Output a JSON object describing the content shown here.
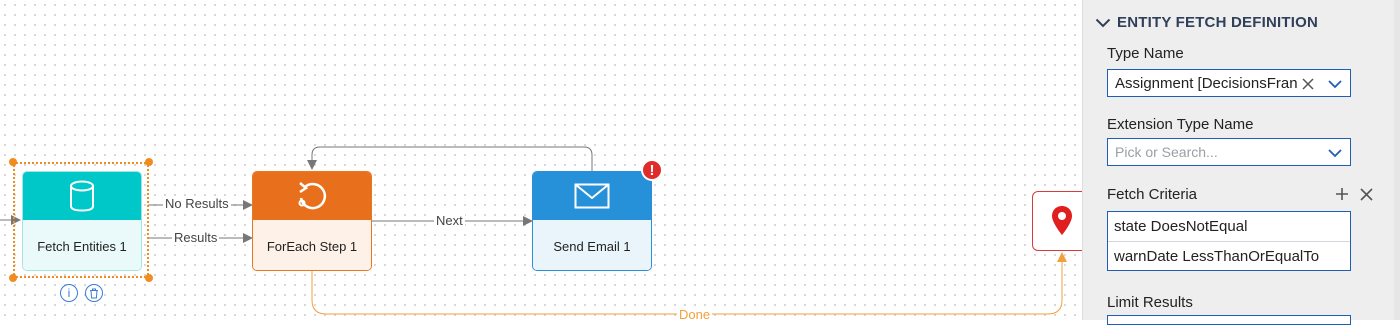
{
  "flow": {
    "nodes": {
      "fetch": {
        "label": "Fetch Entities 1"
      },
      "foreach": {
        "label": "ForEach Step 1"
      },
      "email": {
        "label": "Send Email 1",
        "badge": "!"
      }
    },
    "connections": {
      "no_results": "No Results",
      "results": "Results",
      "next": "Next",
      "done": "Done"
    },
    "node_actions": {
      "info_icon": "info-icon",
      "delete_icon": "trash-icon"
    }
  },
  "panel": {
    "section_title": "ENTITY FETCH DEFINITION",
    "type_name": {
      "label": "Type Name",
      "value": "Assignment   [DecisionsFran"
    },
    "extension_type_name": {
      "label": "Extension Type Name",
      "placeholder": "Pick or Search..."
    },
    "fetch_criteria": {
      "label": "Fetch Criteria",
      "items": [
        "state DoesNotEqual",
        "warnDate LessThanOrEqualTo"
      ]
    },
    "limit_results": {
      "label": "Limit Results"
    }
  },
  "colors": {
    "fetch_node": "#00c8c8",
    "foreach_node": "#e8701c",
    "email_node": "#2691d9",
    "selection": "#f28c1f",
    "error": "#e02b2b",
    "panel_title": "#31405a"
  }
}
